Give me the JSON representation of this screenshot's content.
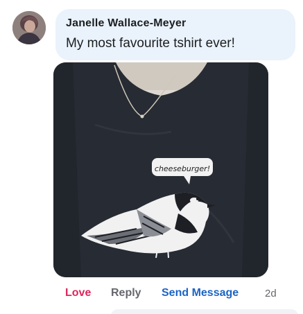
{
  "comment": {
    "author": "Janelle Wallace-Meyer",
    "text": "My most favourite tshirt ever!",
    "avatar_icon": "profile-photo",
    "photo": {
      "subject": "dark t-shirt with chickadee bird print",
      "speech_bubble_text": "cheeseburger!"
    },
    "actions": {
      "love": "Love",
      "reply": "Reply",
      "send_message": "Send Message",
      "timestamp": "2d"
    }
  },
  "colors": {
    "bubble_bg": "#eaf3fb",
    "love": "#e0245e",
    "link_blue": "#1b64c5",
    "muted": "#65676b",
    "shirt": "#272b33"
  }
}
